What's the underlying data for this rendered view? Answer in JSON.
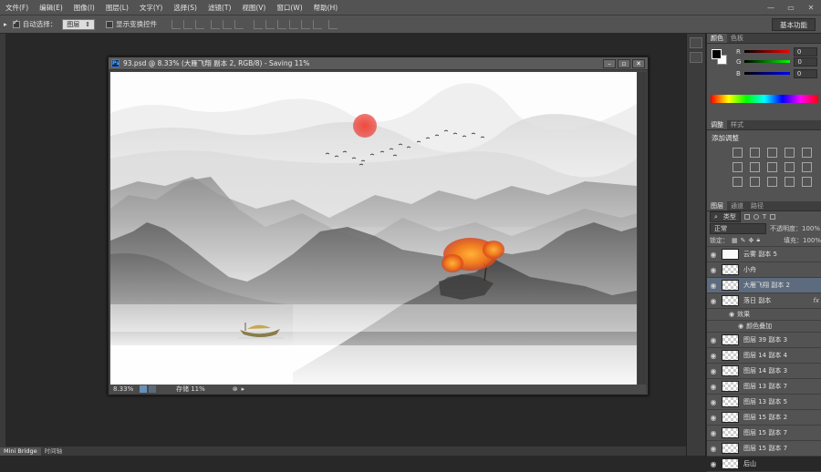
{
  "menubar": {
    "items": [
      "文件(F)",
      "编辑(E)",
      "图像(I)",
      "图层(L)",
      "文字(Y)",
      "选择(S)",
      "滤镜(T)",
      "视图(V)",
      "窗口(W)",
      "帮助(H)"
    ]
  },
  "options": {
    "auto_select_label": "自动选择：",
    "auto_select_value": "图层",
    "show_transform_label": "显示变换控件"
  },
  "workspace": {
    "label": "基本功能"
  },
  "document": {
    "title": "93.psd @ 8.33% (大雁飞翔 副本 2, RGB/8) - Saving 11%",
    "zoom": "8.33%",
    "status": "存储 11%"
  },
  "color_panel": {
    "tabs": [
      "颜色",
      "色板"
    ],
    "r_label": "R",
    "r_value": "0",
    "g_label": "G",
    "g_value": "0",
    "b_label": "B",
    "b_value": "0"
  },
  "adjust_panel": {
    "tabs": [
      "调整",
      "样式"
    ],
    "title": "添加调整"
  },
  "layers_panel": {
    "tabs": [
      "图层",
      "通道",
      "路径"
    ],
    "kind_filter": "类型",
    "blend_mode": "正常",
    "opacity_label": "不透明度：",
    "opacity_value": "100%",
    "lock_label": "锁定：",
    "fill_label": "填充：",
    "fill_value": "100%",
    "layers": [
      {
        "name": "云雾 副本 5",
        "thumb": "white"
      },
      {
        "name": "小舟",
        "thumb": "checker"
      },
      {
        "name": "大雁飞翔 副本 2",
        "thumb": "checker",
        "selected": true
      },
      {
        "name": "落日 副本",
        "thumb": "checker",
        "fx": "fx"
      },
      {
        "name": "图层 39 副本 3",
        "thumb": "checker"
      },
      {
        "name": "图层 14 副本 4",
        "thumb": "checker"
      },
      {
        "name": "图层 14 副本 3",
        "thumb": "checker"
      },
      {
        "name": "图层 13 副本 7",
        "thumb": "checker"
      },
      {
        "name": "图层 13 副本 5",
        "thumb": "checker"
      },
      {
        "name": "图层 15 副本 2",
        "thumb": "checker"
      },
      {
        "name": "图层 15 副本 7",
        "thumb": "checker"
      },
      {
        "name": "图层 15 副本 7",
        "thumb": "checker"
      },
      {
        "name": "后山",
        "thumb": "checker"
      }
    ],
    "effects_label": "效果",
    "effect_item": "颜色叠加"
  },
  "bottom_tabs": [
    "Mini Bridge",
    "时间轴"
  ],
  "colors": {
    "accent": "#5d6b7e",
    "sun": "#e8403a",
    "tree": "#f07a1e"
  }
}
